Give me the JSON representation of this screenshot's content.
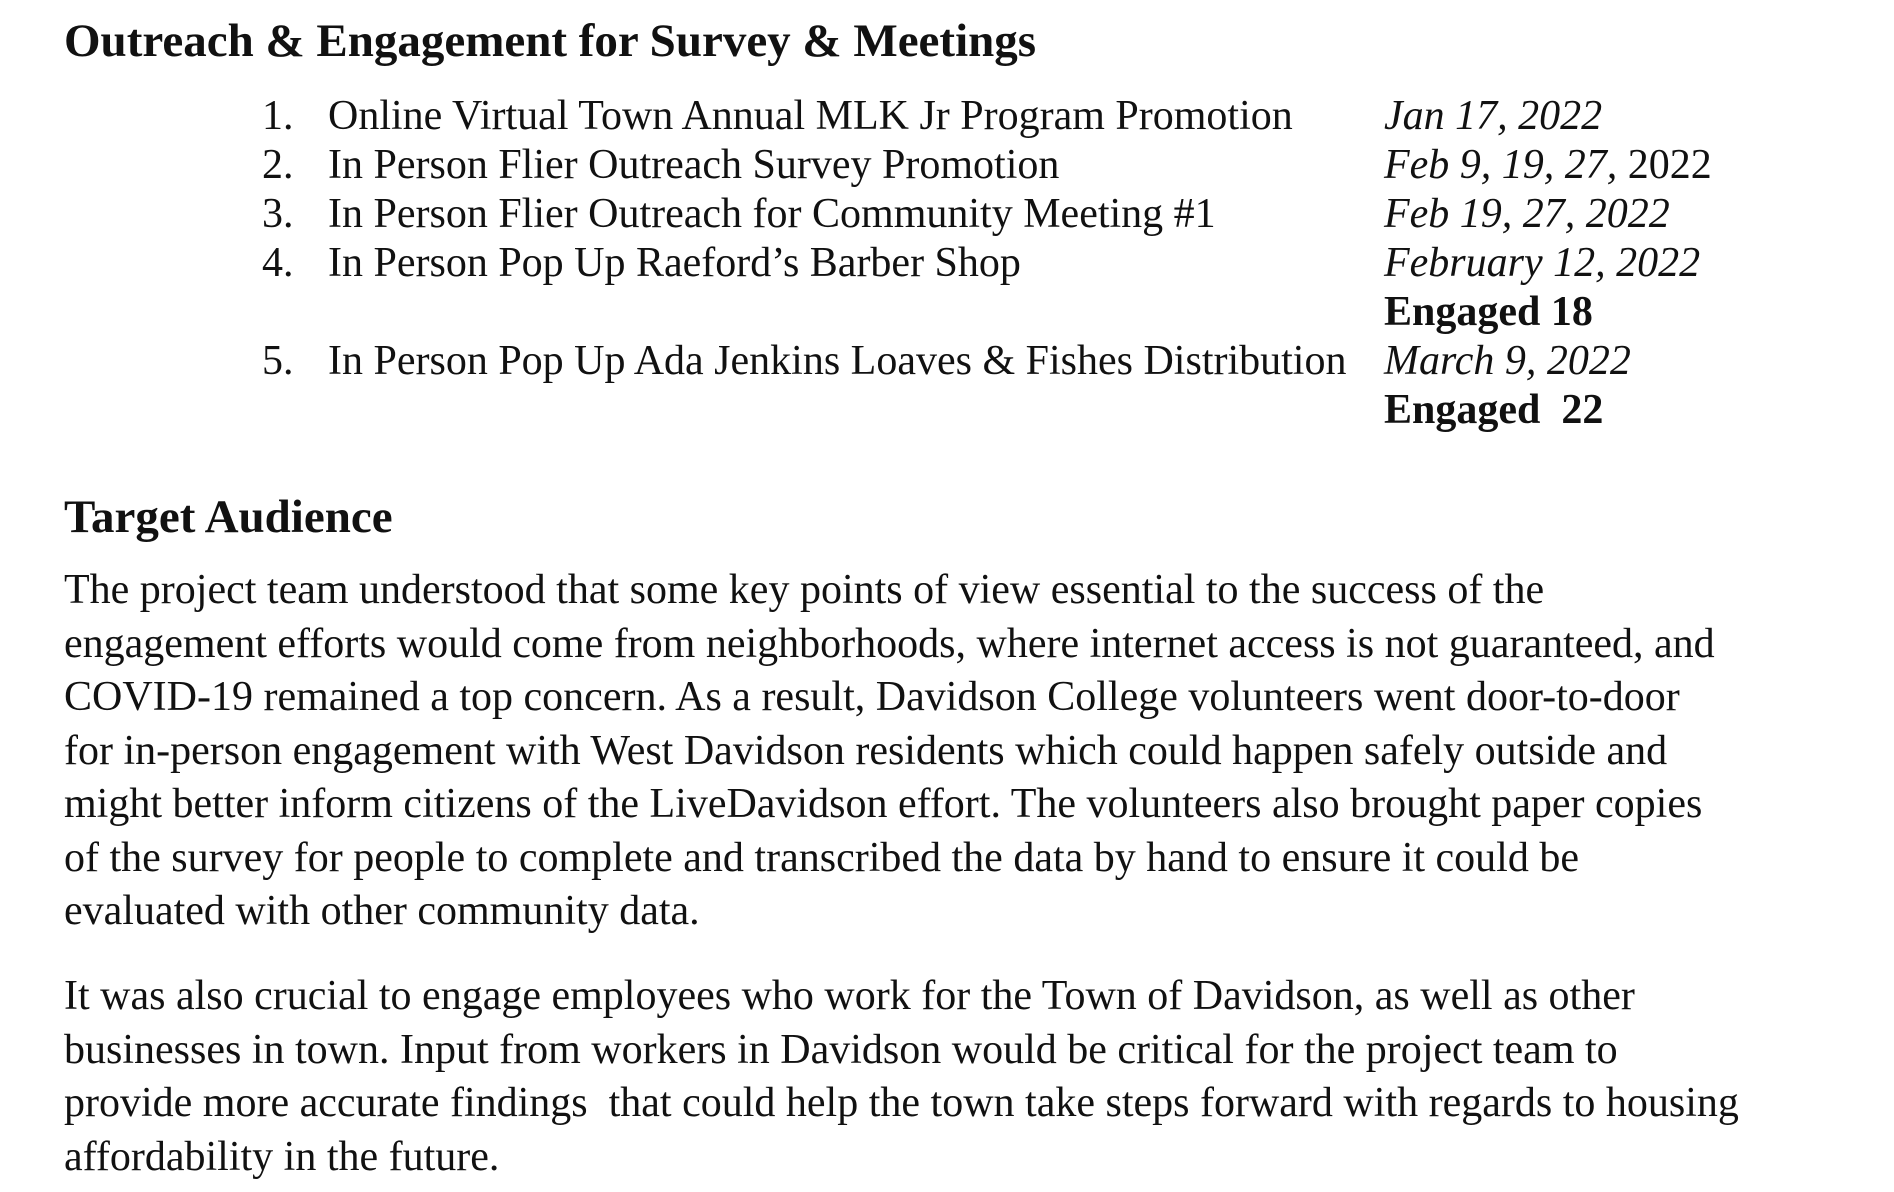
{
  "sections": {
    "outreach": {
      "heading": "Outreach & Engagement for Survey & Meetings",
      "items": [
        {
          "number": "1.",
          "label": "Online Virtual Town Annual MLK Jr Program Promotion",
          "date_italic": "Jan 17, 2022",
          "date_plain": "",
          "engaged": ""
        },
        {
          "number": "2.",
          "label": "In Person Flier Outreach Survey Promotion",
          "date_italic": "Feb 9, 19, 27,",
          "date_plain": " 2022",
          "engaged": ""
        },
        {
          "number": "3.",
          "label": "In Person Flier Outreach for Community Meeting #1",
          "date_italic": "Feb 19, 27, 2022",
          "date_plain": "",
          "engaged": ""
        },
        {
          "number": "4.",
          "label": "In Person Pop Up Raeford’s Barber Shop",
          "date_italic": "February 12, 2022",
          "date_plain": "",
          "engaged": "Engaged 18"
        },
        {
          "number": "5.",
          "label": "In Person Pop Up Ada Jenkins Loaves & Fishes Distribution",
          "date_italic": "March 9, 2022",
          "date_plain": "",
          "engaged": "Engaged  22"
        }
      ]
    },
    "target_audience": {
      "heading": "Target Audience",
      "paragraph_1_lines": [
        "The project team understood that some key points of view essential to the success of the",
        "engagement efforts would come from neighborhoods, where internet access is not guaranteed, and",
        "COVID-19 remained a top concern. As a result, Davidson College volunteers went door-to-door",
        "for in-person engagement with West Davidson residents which could happen safely outside and",
        "might better inform citizens of the LiveDavidson effort. The volunteers also brought paper copies",
        "of the survey for people to complete and transcribed the data by hand to ensure it could be",
        "evaluated with other community data."
      ],
      "paragraph_2_lines": [
        "It was also crucial to engage employees who work for the Town of Davidson, as well as other",
        "businesses in town. Input from workers in Davidson would be critical for the project team to",
        "provide more accurate findings  that could help the town take steps forward with regards to housing",
        "affordability in the future."
      ]
    }
  }
}
